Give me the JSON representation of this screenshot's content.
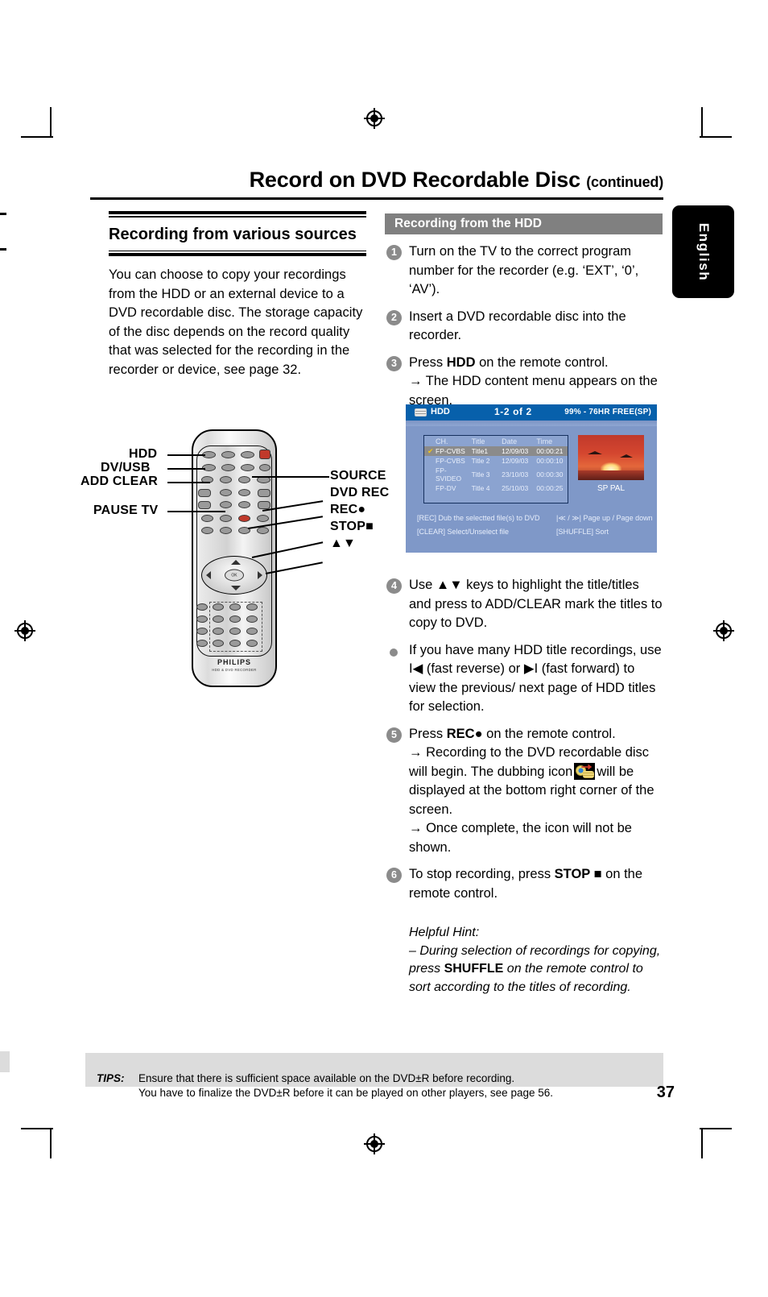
{
  "header": {
    "title": "Record on DVD Recordable Disc",
    "continued": "(continued)",
    "language_tab": "English"
  },
  "left_column": {
    "section_title": "Recording from various sources",
    "paragraph": "You can choose to copy your recordings from the HDD or an external device to a DVD recordable disc. The storage capacity of the disc depends on the record quality that was selected for the recording in the recorder or device, see page 32."
  },
  "remote": {
    "brand": "PHILIPS",
    "brand_sub": "HDD & DVD RECORDER",
    "ok_label": "OK",
    "labels_left": [
      "HDD",
      "DV/USB",
      "ADD CLEAR",
      "PAUSE TV"
    ],
    "labels_right": [
      "SOURCE",
      "DVD REC",
      "REC",
      "STOP",
      "▲▼"
    ]
  },
  "right_column": {
    "section_band": "Recording from the HDD",
    "steps": [
      {
        "num": "1",
        "text": "Turn on the TV to the correct program number for the recorder (e.g. ‘EXT’, ‘0’, ‘AV’)."
      },
      {
        "num": "2",
        "text": "Insert a DVD recordable disc into the recorder."
      },
      {
        "num": "3",
        "text_pre": "Press ",
        "text_bold": "HDD",
        "text_post": " on the remote control.",
        "result": "→ The HDD content menu appears on the screen."
      },
      {
        "num": "4",
        "text": "Use ▲▼ keys to highlight the title/titles and press  to ADD/CLEAR mark the titles to copy to DVD."
      },
      {
        "num": "•",
        "text": "If you have many HDD title recordings, use I◀ (fast reverse) or ▶I (fast forward) to view the previous/ next page of HDD titles for selection."
      },
      {
        "num": "5",
        "text_pre": "Press ",
        "text_bold": "REC●",
        "text_post": " on the remote control.",
        "result": "→ Recording to the DVD recordable disc will begin. The dubbing icon",
        "result2": "will be displayed at the bottom right corner of the screen.",
        "result3": "→ Once complete, the icon will not be shown."
      },
      {
        "num": "6",
        "text_pre": "To stop recording, press ",
        "text_bold": "STOP ■",
        "text_post": " on the remote control."
      }
    ],
    "hint_title": "Helpful Hint:",
    "hint_pre": "–  During selection of recordings for copying, press ",
    "hint_bold": "SHUFFLE",
    "hint_post": " on the remote control to sort according to the titles of recording."
  },
  "tv_screen": {
    "source_label": "HDD",
    "page_indicator": "1-2  of  2",
    "free_space": "99% - 76HR  FREE(SP)",
    "columns": [
      "CH.",
      "Title",
      "Date",
      "Time"
    ],
    "rows": [
      {
        "ch": "FP-CVBS",
        "title": "Title1",
        "date": "12/09/03",
        "time": "00:00:21",
        "selected": true,
        "marked": true
      },
      {
        "ch": "FP-CVBS",
        "title": "Title 2",
        "date": "12/09/03",
        "time": "00:00:10",
        "selected": false,
        "marked": false
      },
      {
        "ch": "FP-SVIDEO",
        "title": "Title 3",
        "date": "23/10/03",
        "time": "00:00:30",
        "selected": false,
        "marked": false
      },
      {
        "ch": "FP-DV",
        "title": "Title 4",
        "date": "25/10/03",
        "time": "00:00:25",
        "selected": false,
        "marked": false
      }
    ],
    "quality_label": "SP PAL",
    "footer": {
      "rec": "[REC]  Dub the selectted file(s) to DVD",
      "clear": "[CLEAR]  Select/Unselect file",
      "page": "|≪ / ≫| Page up / Page down",
      "shuffle": "[SHUFFLE]  Sort"
    },
    "colors": {
      "header_bar": "#0760ab",
      "background": "#7f98c8",
      "selected_row": "#8b8b8b"
    }
  },
  "footer": {
    "tips_key": "TIPS:",
    "tips_line1": "Ensure that there is sufficient space available on the DVD±R before recording.",
    "tips_line2": "You have to finalize the DVD±R before it can be played on other players, see page 56.",
    "page_number": "37"
  }
}
